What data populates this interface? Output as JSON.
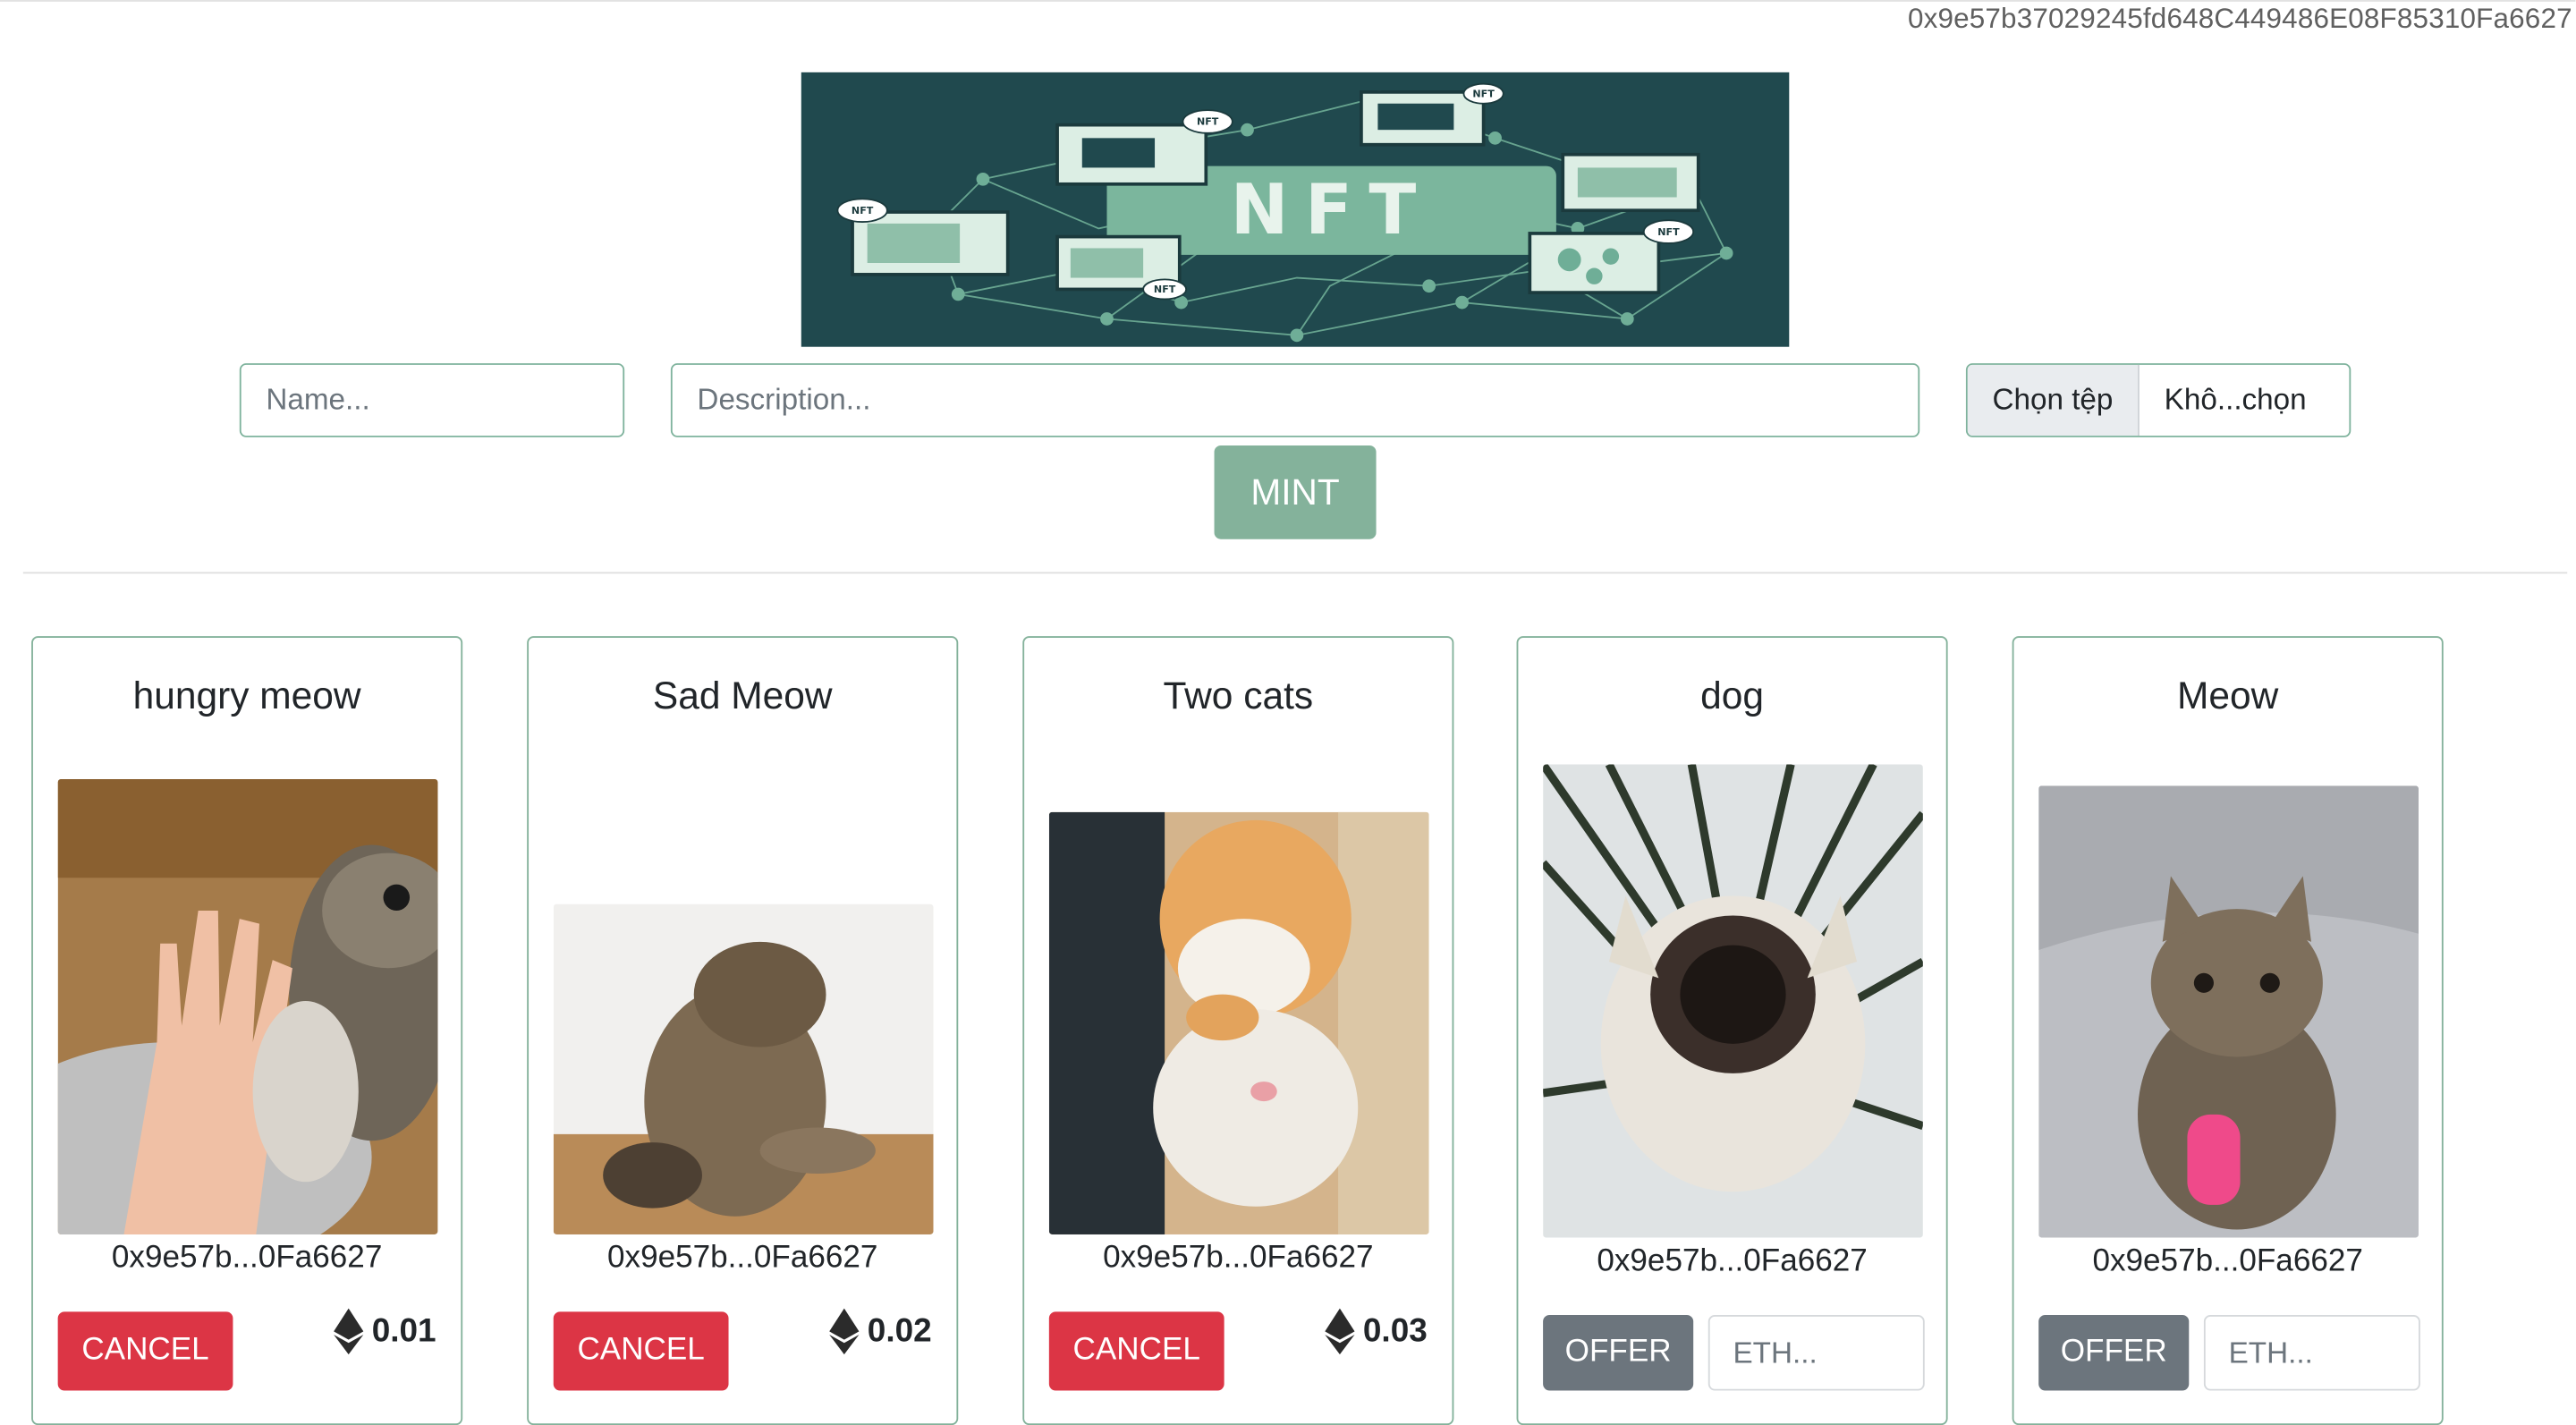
{
  "header": {
    "address": "0x9e57b37029245fd648C449486E08F85310Fa6627"
  },
  "banner": {
    "text": "NFT",
    "tags": [
      "NFT",
      "NFT",
      "NFT",
      "NFT",
      "NFT"
    ]
  },
  "mint_form": {
    "name_placeholder": "Name...",
    "description_placeholder": "Description...",
    "file_button": "Chọn tệp",
    "file_status": "Khô...chọn",
    "mint_label": "MINT"
  },
  "cards": [
    {
      "title": "hungry meow",
      "owner": "0x9e57b...0Fa6627",
      "action": "CANCEL",
      "price": "0.01"
    },
    {
      "title": "Sad Meow",
      "owner": "0x9e57b...0Fa6627",
      "action": "CANCEL",
      "price": "0.02"
    },
    {
      "title": "Two cats",
      "owner": "0x9e57b...0Fa6627",
      "action": "CANCEL",
      "price": "0.03"
    },
    {
      "title": "dog",
      "owner": "0x9e57b...0Fa6627",
      "action": "OFFER",
      "offer_placeholder": "ETH..."
    },
    {
      "title": "Meow",
      "owner": "0x9e57b...0Fa6627",
      "action": "OFFER",
      "offer_placeholder": "ETH..."
    }
  ],
  "colors": {
    "accent": "#84b29b",
    "border": "#7fb39d",
    "cancel": "#dc3545",
    "offer": "#6c757d",
    "banner_bg": "#20494e"
  },
  "icons": {
    "price": "ethereum-icon"
  }
}
